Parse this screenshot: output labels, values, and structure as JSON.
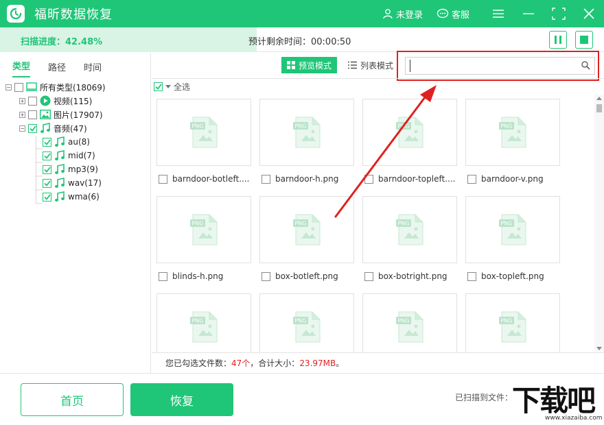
{
  "app": {
    "title": "福昕数据恢复",
    "login_label": "未登录",
    "support_label": "客服"
  },
  "progress": {
    "label": "扫描进度：42.48%",
    "fraction": 0.4248,
    "remaining_label": "预计剩余时间：00:00:50"
  },
  "left_tabs": [
    "类型",
    "路径",
    "时间"
  ],
  "tree": {
    "root": "所有类型(18069)",
    "video": "视频(115)",
    "image": "图片(17907)",
    "audio": "音频(47)",
    "children": [
      "au(8)",
      "mid(7)",
      "mp3(9)",
      "wav(17)",
      "wma(6)"
    ]
  },
  "toolbar": {
    "preview_label": "预览模式",
    "list_label": "列表模式",
    "search_placeholder": ""
  },
  "select_all_label": "全选",
  "files": [
    "barndoor-botleft....",
    "barndoor-h.png",
    "barndoor-topleft....",
    "barndoor-v.png",
    "blinds-h.png",
    "box-botleft.png",
    "box-botright.png",
    "box-topleft.png",
    "",
    "",
    "",
    ""
  ],
  "thumb_badge": "PNG",
  "summary": {
    "prefix": "您已勾选文件数：",
    "count": "47个",
    "middle": "，合计大小：",
    "size": "23.97MB",
    "suffix": "。"
  },
  "footer": {
    "home_label": "首页",
    "recover_label": "恢复",
    "scanned_label": "已扫描到文件："
  },
  "watermark": {
    "big": "下载吧",
    "small": "www.xiazaiba.com"
  },
  "colors": {
    "accent": "#1fc677",
    "highlight": "#e02020"
  }
}
